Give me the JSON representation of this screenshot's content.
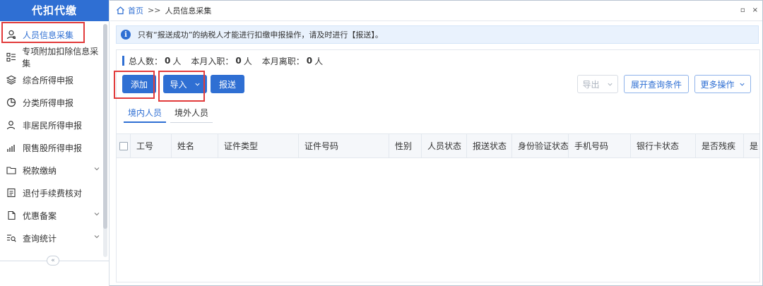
{
  "sidebar": {
    "title": "代扣代缴",
    "items": [
      {
        "label": "人员信息采集",
        "icon": "person-icon",
        "active": true
      },
      {
        "label": "专项附加扣除信息采集",
        "icon": "list-icon"
      },
      {
        "label": "综合所得申报",
        "icon": "layers-icon"
      },
      {
        "label": "分类所得申报",
        "icon": "pie-chart-icon"
      },
      {
        "label": "非居民所得申报",
        "icon": "user-icon"
      },
      {
        "label": "限售股所得申报",
        "icon": "bar-chart-icon"
      },
      {
        "label": "税款缴纳",
        "icon": "folder-icon",
        "expandable": true
      },
      {
        "label": "退付手续费核对",
        "icon": "document-icon"
      },
      {
        "label": "优惠备案",
        "icon": "file-icon",
        "expandable": true
      },
      {
        "label": "查询统计",
        "icon": "search-list-icon",
        "expandable": true
      }
    ],
    "collapse_icon": "«"
  },
  "breadcrumb": {
    "home": "首页",
    "separator": ">>",
    "current": "人员信息采集"
  },
  "window_buttons": {
    "restore": "▫",
    "close": "×"
  },
  "notice": {
    "icon": "i",
    "text": "只有“报送成功”的纳税人才能进行扣缴申报操作，请及时进行【报送】。"
  },
  "stats": {
    "total_label": "总人数：",
    "total_value": "0",
    "total_unit": "人",
    "hired_label": "本月入职：",
    "hired_value": "0",
    "hired_unit": "人",
    "left_label": "本月离职：",
    "left_value": "0",
    "left_unit": "人"
  },
  "toolbar": {
    "add": "添加",
    "import": "导入",
    "submit": "报送",
    "export": "导出",
    "expand_query": "展开查询条件",
    "more_actions": "更多操作"
  },
  "tabs": [
    "境内人员",
    "境外人员"
  ],
  "table": {
    "columns": [
      "工号",
      "姓名",
      "证件类型",
      "证件号码",
      "性别",
      "人员状态",
      "报送状态",
      "身份验证状态",
      "手机号码",
      "银行卡状态",
      "是否残疾",
      "是"
    ]
  },
  "colors": {
    "primary": "#2f6fd3",
    "highlight": "#e23b3b"
  }
}
